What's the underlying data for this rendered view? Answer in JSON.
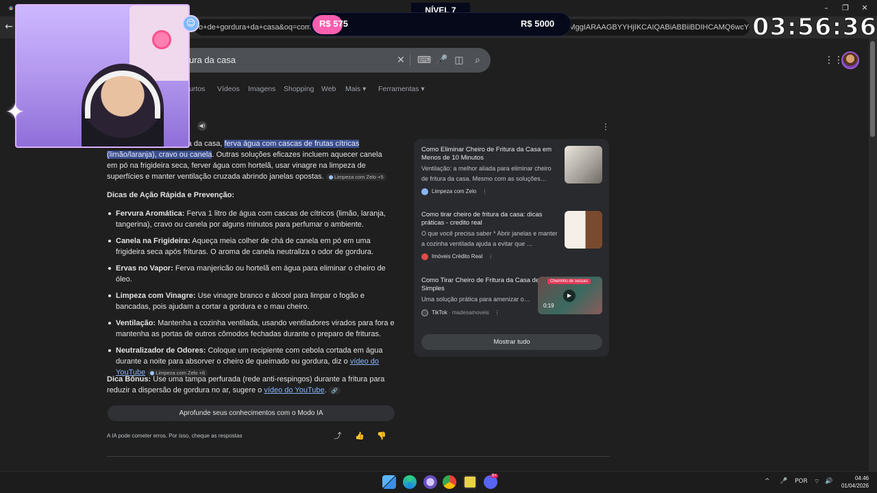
{
  "browser": {
    "url": "o+de+gordura+da+casa&oq=como+t",
    "url_tail": "dhg5MggIARAAGBYYHjIKCAIQABiABBiiBDIHCAMQ6wcYQNIBCD",
    "back_icon": "back-arrow-icon",
    "window_controls": [
      "minimize-icon",
      "maximize-icon",
      "close-icon"
    ]
  },
  "search": {
    "query": "ura da casa",
    "icons": [
      "clear-icon",
      "keyboard-icon",
      "mic-icon",
      "lens-icon",
      "search-icon"
    ]
  },
  "nav_tabs": [
    {
      "label": "urtos"
    },
    {
      "label": "Vídeos"
    },
    {
      "label": "Imagens"
    },
    {
      "label": "Shopping"
    },
    {
      "label": "Web"
    },
    {
      "label": "Mais ▾"
    },
    {
      "label": "Ferramentas ▾"
    }
  ],
  "ai_overview": {
    "intro_prefix": "ra da casa, ",
    "intro_highlight_1": "ferva água com cascas de frutas cítricas",
    "intro_highlight_2": "(limão/laranja), cravo ou canela",
    "intro_rest": ". Outras soluções eficazes incluem aquecer canela em pó na frigideira seca, ferver água com hortelã, usar vinagre na limpeza de superfícies e manter ventilação cruzada abrindo janelas opostas.",
    "intro_chip": "Limpeza com Zelo +5",
    "tips_heading": "Dicas de Ação Rápida e Prevenção:",
    "tips": [
      {
        "title": "Fervura Aromática:",
        "text": "Ferva 1 litro de água com cascas de cítricos (limão, laranja, tangerina), cravo ou canela por alguns minutos para perfumar o ambiente."
      },
      {
        "title": "Canela na Frigideira:",
        "text": "Aqueça meia colher de chá de canela em pó em uma frigideira seca após frituras. O aroma de canela neutraliza o odor de gordura."
      },
      {
        "title": "Ervas no Vapor:",
        "text": "Ferva manjericão ou hortelã em água para eliminar o cheiro de óleo."
      },
      {
        "title": "Limpeza com Vinagre:",
        "text": "Use vinagre branco e álcool para limpar o fogão e bancadas, pois ajudam a cortar a gordura e o mau cheiro."
      },
      {
        "title": "Ventilação:",
        "text": "Mantenha a cozinha ventilada, usando ventiladores virados para fora e mantenha as portas de outros cômodos fechadas durante o preparo de frituras."
      },
      {
        "title": "Neutralizador de Odores:",
        "text": "Coloque um recipiente com cebola cortada em água durante a noite para absorver o cheiro de queimado ou gordura, diz o ",
        "link": "vídeo do YouTube",
        "chip": "Limpeza com Zelo +6"
      }
    ],
    "bonus_title": "Dica Bônus:",
    "bonus_text": "Use uma tampa perfurada (rede anti-respingos) durante a fritura para reduzir a dispersão de gordura no ar, sugere o ",
    "bonus_link": "vídeo do YouTube",
    "bonus_end": ".",
    "deep_button": "Aprofunde seus conhecimentos com o Modo IA",
    "disclaimer": "A IA pode cometer erros. Por isso, cheque as respostas",
    "feedback_icons": [
      "share-icon",
      "thumbs-up-icon",
      "thumbs-down-icon"
    ]
  },
  "sources": [
    {
      "title": "Como Eliminar Cheiro de Fritura da Casa em Menos de 10 Minutos",
      "desc": "Ventilação: a melhor aliada para eliminar cheiro de fritura da casa. Mesmo com as soluções…",
      "source": "Limpeza com Zelo"
    },
    {
      "title": "Como tirar cheiro de fritura da casa: dicas práticas - credito real",
      "desc": "O que você precisa saber * Abrir janelas e manter a cozinha ventilada ajuda a evitar que …",
      "source": "Imóveis Crédito Real"
    },
    {
      "title": "Como Tirar Cheiro de Fritura da Casa de Forma Simples",
      "desc": "Uma solução prática para amenizar o…",
      "source": "TikTok",
      "source_sub": "· madesamoveis",
      "video_duration": "0:19",
      "video_label": "Cheirinho de sessao"
    }
  ],
  "show_all": "Mostrar tudo",
  "stream": {
    "level": "NÍVEL 7",
    "left_value": "R$ 575",
    "right_value": "R$ 5000",
    "timer": "03:56:36",
    "progress_fraction": 0.115
  },
  "taskbar": {
    "apps": [
      "windows-start-icon",
      "edge-icon",
      "app-icon",
      "chrome-icon",
      "notes-icon",
      "discord-icon"
    ],
    "discord_badge": "9+",
    "lang": "POR",
    "time": "04:46",
    "date": "01/04/2026"
  },
  "colors": {
    "accent_pink": "#ff5fae",
    "link": "#8ab4f8",
    "highlight": "#3b4f8c",
    "hud_bg": "#06091a"
  }
}
